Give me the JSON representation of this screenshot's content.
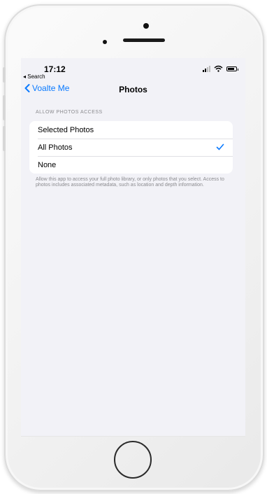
{
  "status_bar": {
    "time": "17:12",
    "back_app": "◂ Search"
  },
  "navbar": {
    "back_label": "Voalte Me",
    "title": "Photos"
  },
  "section": {
    "header": "ALLOW PHOTOS ACCESS",
    "options": [
      {
        "label": "Selected Photos",
        "selected": false
      },
      {
        "label": "All Photos",
        "selected": true
      },
      {
        "label": "None",
        "selected": false
      }
    ],
    "footer": "Allow this app to access your full photo library, or only photos that you select. Access to photos includes associated metadata, such as location and depth information."
  },
  "colors": {
    "accent": "#0a7aff",
    "background": "#f2f2f7",
    "secondary_text": "#8a8a8e"
  }
}
